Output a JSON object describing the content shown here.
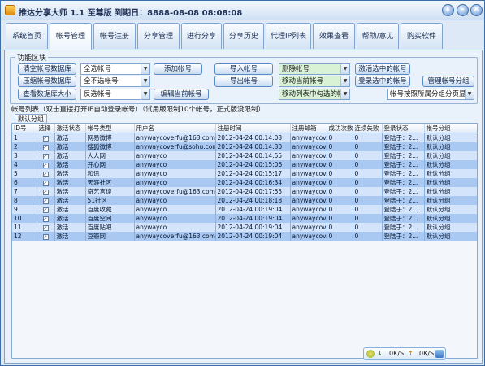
{
  "window": {
    "title": "推达分享大师 1.1 至尊版 到期日：8888-08-08 08:08:08",
    "buttons": [
      "⇩",
      "–",
      "✕"
    ]
  },
  "tabs": [
    {
      "label": "系统首页",
      "active": false
    },
    {
      "label": "帐号管理",
      "active": true
    },
    {
      "label": "帐号注册",
      "active": false
    },
    {
      "label": "分享管理",
      "active": false
    },
    {
      "label": "进行分享",
      "active": false
    },
    {
      "label": "分享历史",
      "active": false
    },
    {
      "label": "代理IP列表",
      "active": false
    },
    {
      "label": "效果查看",
      "active": false
    },
    {
      "label": "帮助/意见",
      "active": false
    },
    {
      "label": "购买软件",
      "active": false
    }
  ],
  "functions": {
    "legend": "功能区块",
    "clear_db": "清空帐号数据库",
    "compress_db": "压缩帐号数据库",
    "view_db_size": "查看数据库大小",
    "select_all": "全选帐号",
    "select_none": "全不选帐号",
    "select_invert": "反选帐号",
    "add_account": "添加帐号",
    "edit_account": "编辑当前帐号",
    "import_account": "导入帐号",
    "export_account": "导出帐号",
    "delete_account": "删除帐号",
    "move_current": "移动当前帐号",
    "move_checked": "移动列表中勾选的帐",
    "activate_checked": "激活选中的帐号",
    "login_checked": "登录选中的帐号",
    "manage_groups": "管理帐号分组",
    "paginate_by_group": "帐号按照所属分组分页显"
  },
  "list": {
    "title": "帐号列表（双击直接打开IE自动登录帐号）（试用版限制10个帐号，正式版没限制）",
    "group_tab": "默认分组",
    "columns": [
      "ID号",
      "选择",
      "激活状态",
      "帐号类型",
      "用户名",
      "注册时间",
      "注册邮箱",
      "成功次数",
      "连续失败",
      "登录状态",
      "帐号分组"
    ],
    "rows": [
      {
        "id": "1",
        "checked": "✓",
        "status": "激活",
        "type": "网易微博",
        "user": "anywaycoverfu@163.com",
        "time": "2012-04-24 00:14:03",
        "email": "anywaycov...",
        "success": "0",
        "fail": "0",
        "login": "登陆于：2...",
        "group": "默认分组"
      },
      {
        "id": "2",
        "checked": "✓",
        "status": "激活",
        "type": "搜狐微博",
        "user": "anywaycoverfu@sohu.com",
        "time": "2012-04-24 00:14:30",
        "email": "anywaycov...",
        "success": "0",
        "fail": "0",
        "login": "登陆于：2...",
        "group": "默认分组"
      },
      {
        "id": "3",
        "checked": "✓",
        "status": "激活",
        "type": "人人网",
        "user": "anywayco",
        "time": "2012-04-24 00:14:55",
        "email": "anywaycov...",
        "success": "0",
        "fail": "0",
        "login": "登陆于：2...",
        "group": "默认分组"
      },
      {
        "id": "4",
        "checked": "✓",
        "status": "激活",
        "type": "开心网",
        "user": "anywayco",
        "time": "2012-04-24 00:15:06",
        "email": "anywaycov...",
        "success": "0",
        "fail": "0",
        "login": "登陆于：2...",
        "group": "默认分组"
      },
      {
        "id": "5",
        "checked": "✓",
        "status": "激活",
        "type": "和讯",
        "user": "anywayco",
        "time": "2012-04-24 00:15:17",
        "email": "anywaycov...",
        "success": "0",
        "fail": "0",
        "login": "登陆于：2...",
        "group": "默认分组"
      },
      {
        "id": "6",
        "checked": "✓",
        "status": "激活",
        "type": "天涯社区",
        "user": "anywayco",
        "time": "2012-04-24 00:16:34",
        "email": "anywaycov...",
        "success": "0",
        "fail": "0",
        "login": "登陆于：2...",
        "group": "默认分组"
      },
      {
        "id": "7",
        "checked": "✓",
        "status": "激活",
        "type": "奇艺宫谈",
        "user": "anywaycoverfu@163.com",
        "time": "2012-04-24 00:17:55",
        "email": "anywaycov...",
        "success": "0",
        "fail": "0",
        "login": "登陆于：2...",
        "group": "默认分组"
      },
      {
        "id": "8",
        "checked": "✓",
        "status": "激活",
        "type": "51社区",
        "user": "anywayco",
        "time": "2012-04-24 00:18:18",
        "email": "anywaycov...",
        "success": "0",
        "fail": "0",
        "login": "登陆于：2...",
        "group": "默认分组"
      },
      {
        "id": "9",
        "checked": "✓",
        "status": "激活",
        "type": "百度收藏",
        "user": "anywayco",
        "time": "2012-04-24 00:19:04",
        "email": "anywaycov...",
        "success": "0",
        "fail": "0",
        "login": "登陆于：2...",
        "group": "默认分组"
      },
      {
        "id": "10",
        "checked": "✓",
        "status": "激活",
        "type": "百度空间",
        "user": "anywayco",
        "time": "2012-04-24 00:19:04",
        "email": "anywaycov...",
        "success": "0",
        "fail": "0",
        "login": "登陆于：2...",
        "group": "默认分组"
      },
      {
        "id": "11",
        "checked": "✓",
        "status": "激活",
        "type": "百度贴吧",
        "user": "anywayco",
        "time": "2012-04-24 00:19:04",
        "email": "anywaycov...",
        "success": "0",
        "fail": "0",
        "login": "登陆于：2...",
        "group": "默认分组"
      },
      {
        "id": "12",
        "checked": "✓",
        "status": "激活",
        "type": "豆瓣网",
        "user": "anywaycoverfu@163.com",
        "time": "2012-04-24 00:19:04",
        "email": "anywaycov...",
        "success": "0",
        "fail": "0",
        "login": "登陆于：2...",
        "group": "默认分组"
      }
    ]
  },
  "status": {
    "download": "0K/S",
    "upload": "0K/S"
  },
  "colors": {
    "row_light": "#d4e5fb",
    "row_dark": "#a9c9f2",
    "accent": "#3b6ea8"
  }
}
